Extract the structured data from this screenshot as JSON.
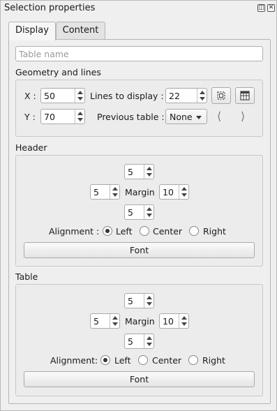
{
  "window": {
    "title": "Selection properties"
  },
  "tabs": [
    {
      "label": "Display"
    },
    {
      "label": "Content"
    }
  ],
  "table_name": {
    "placeholder": "Table name",
    "value": ""
  },
  "geometry": {
    "section_label": "Geometry and lines",
    "x_label": "X :",
    "x_value": "50",
    "y_label": "Y :",
    "y_value": "70",
    "lines_label": "Lines to display :",
    "lines_value": "22",
    "previous_label": "Previous table :",
    "previous_value": "None"
  },
  "header": {
    "section_label": "Header",
    "margin_top": "5",
    "margin_left": "5",
    "margin_label": "Margin",
    "margin_right": "10",
    "margin_bottom": "5",
    "alignment_label": "Alignment :",
    "align_left": "Left",
    "align_center": "Center",
    "align_right": "Right",
    "selected_alignment": "Left",
    "font_button": "Font"
  },
  "table": {
    "section_label": "Table",
    "margin_top": "5",
    "margin_left": "5",
    "margin_label": "Margin",
    "margin_right": "10",
    "margin_bottom": "5",
    "alignment_label": "Alignment:",
    "align_left": "Left",
    "align_center": "Center",
    "align_right": "Right",
    "selected_alignment": "Left",
    "font_button": "Font"
  }
}
